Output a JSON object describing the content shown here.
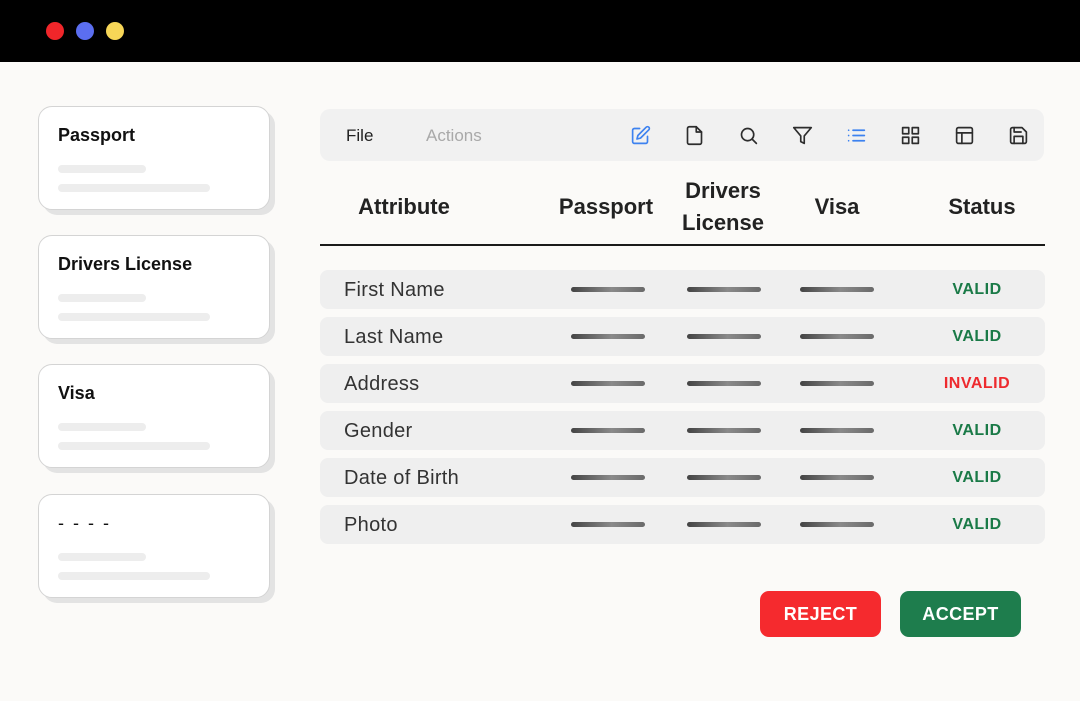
{
  "colors": {
    "valid": "#1a7a47",
    "invalid": "#ee2a2e",
    "reject": "#f52a2e",
    "accept": "#1e7d4d",
    "accent": "#3d82f0"
  },
  "sidebar": {
    "cards": [
      {
        "title": "Passport"
      },
      {
        "title": "Drivers License"
      },
      {
        "title": "Visa"
      },
      {
        "title": "- - - -"
      }
    ]
  },
  "toolbar": {
    "menu": {
      "file": "File",
      "actions": "Actions"
    },
    "icons": [
      "edit-icon",
      "file-icon",
      "search-icon",
      "filter-icon",
      "list-icon",
      "grid-icon",
      "layout-icon",
      "save-icon"
    ]
  },
  "table": {
    "headers": {
      "attribute": "Attribute",
      "passport": "Passport",
      "drivers_license_line1": "Drivers",
      "drivers_license_line2": "License",
      "visa": "Visa",
      "status": "Status"
    },
    "rows": [
      {
        "label": "First Name",
        "status": "VALID",
        "valid": true
      },
      {
        "label": "Last Name",
        "status": "VALID",
        "valid": true
      },
      {
        "label": "Address",
        "status": "INVALID",
        "valid": false
      },
      {
        "label": "Gender",
        "status": "VALID",
        "valid": true
      },
      {
        "label": "Date of Birth",
        "status": "VALID",
        "valid": true
      },
      {
        "label": "Photo",
        "status": "VALID",
        "valid": true
      }
    ]
  },
  "actions": {
    "reject_label": "REJECT",
    "accept_label": "ACCEPT"
  }
}
